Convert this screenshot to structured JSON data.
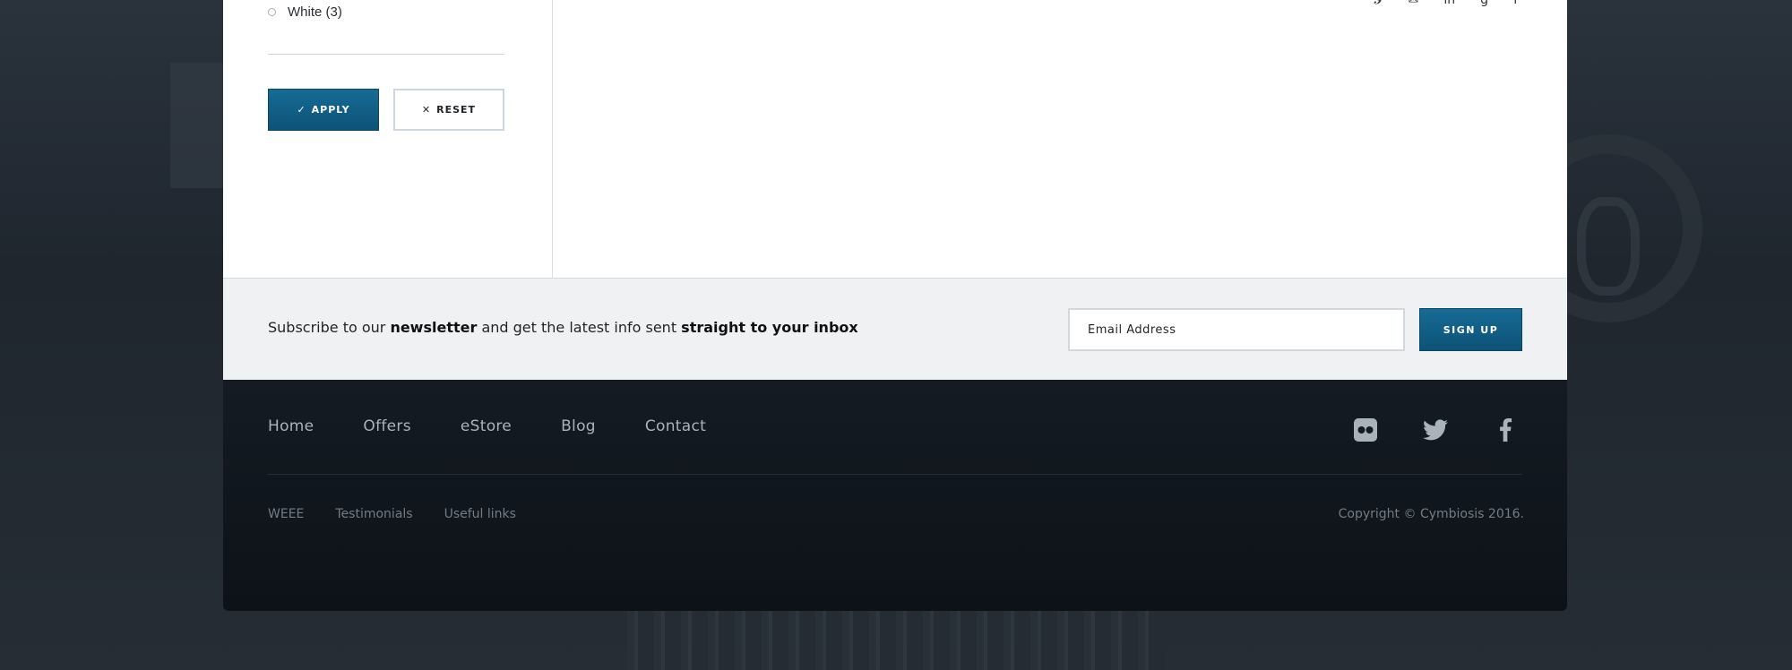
{
  "filters": {
    "option_label": "White (3)",
    "apply_label": "APPLY",
    "reset_label": "RESET"
  },
  "share": {
    "icons": [
      "pinterest-icon",
      "email-icon",
      "linkedin-icon",
      "google-plus-icon",
      "facebook-icon"
    ]
  },
  "newsletter": {
    "text_prefix": "Subscribe to our ",
    "text_bold1": "newsletter",
    "text_middle": " and get the latest info sent ",
    "text_bold2": "straight to your inbox",
    "email_placeholder": "Email Address",
    "signup_label": "SIGN UP"
  },
  "footer": {
    "nav": [
      "Home",
      "Offers",
      "eStore",
      "Blog",
      "Contact"
    ],
    "social": [
      "flickr-icon",
      "twitter-icon",
      "facebook-icon"
    ],
    "sub_links": [
      "WEEE",
      "Testimonials",
      "Useful links"
    ],
    "copyright": "Copyright © Cymbiosis 2016."
  },
  "colors": {
    "accent": "#0f5c85",
    "footer_bg": "#0f151b",
    "newsletter_bg": "#eff1f3"
  }
}
